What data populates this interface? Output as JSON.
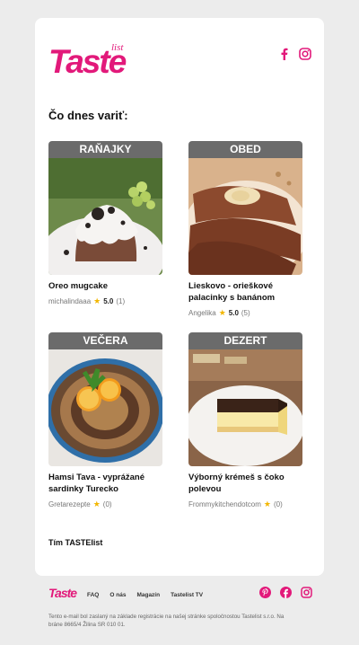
{
  "brand": {
    "logo_text": "Taste",
    "logo_sub": "list",
    "accent": "#e2197a"
  },
  "header": {
    "social": [
      "facebook-icon",
      "instagram-icon"
    ]
  },
  "heading": "Čo dnes variť:",
  "recipes": [
    {
      "category": "RAŇAJKY",
      "title": "Oreo mugcake",
      "author": "michalindaaa",
      "rating": "5.0",
      "count": "(1)"
    },
    {
      "category": "OBED",
      "title": "Lieskovo - orieškové palacinky s banánom",
      "author": "Angelika",
      "rating": "5.0",
      "count": "(5)"
    },
    {
      "category": "VEČERA",
      "title": "Hamsi Tava - vyprážané sardinky Turecko",
      "author": "Gretarezepte",
      "rating": "",
      "count": "(0)"
    },
    {
      "category": "DEZERT",
      "title": "Výborný krémeš s čoko polevou",
      "author": "Frommykitchendotcom",
      "rating": "",
      "count": "(0)"
    }
  ],
  "signature": "Tím TASTElist",
  "footer": {
    "logo_text": "Taste",
    "links": [
      "FAQ",
      "O nás",
      "Magazín",
      "Tastelist TV"
    ],
    "social": [
      "pinterest-icon",
      "facebook-icon",
      "instagram-icon"
    ],
    "legal": "Tento e-mail bol zaslaný na základe registrácie na našej stránke spoločnostou Tastelist s.r.o. Na bráne 8665/4 Žilina SR 010 01."
  }
}
